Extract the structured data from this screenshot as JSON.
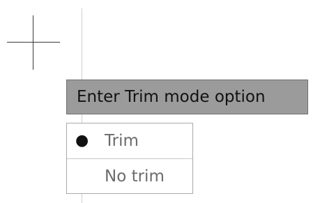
{
  "canvas": {
    "cursor_icon": "crosshair-icon"
  },
  "prompt": {
    "text": "Enter Trim mode option"
  },
  "options": [
    {
      "label": "Trim",
      "selected": true
    },
    {
      "label": "No trim",
      "selected": false
    }
  ],
  "colors": {
    "prompt_background": "#9b9b9b",
    "option_text": "#6b6b6b",
    "selected_bullet": "#111111",
    "guide_line": "#cfcfcf"
  }
}
